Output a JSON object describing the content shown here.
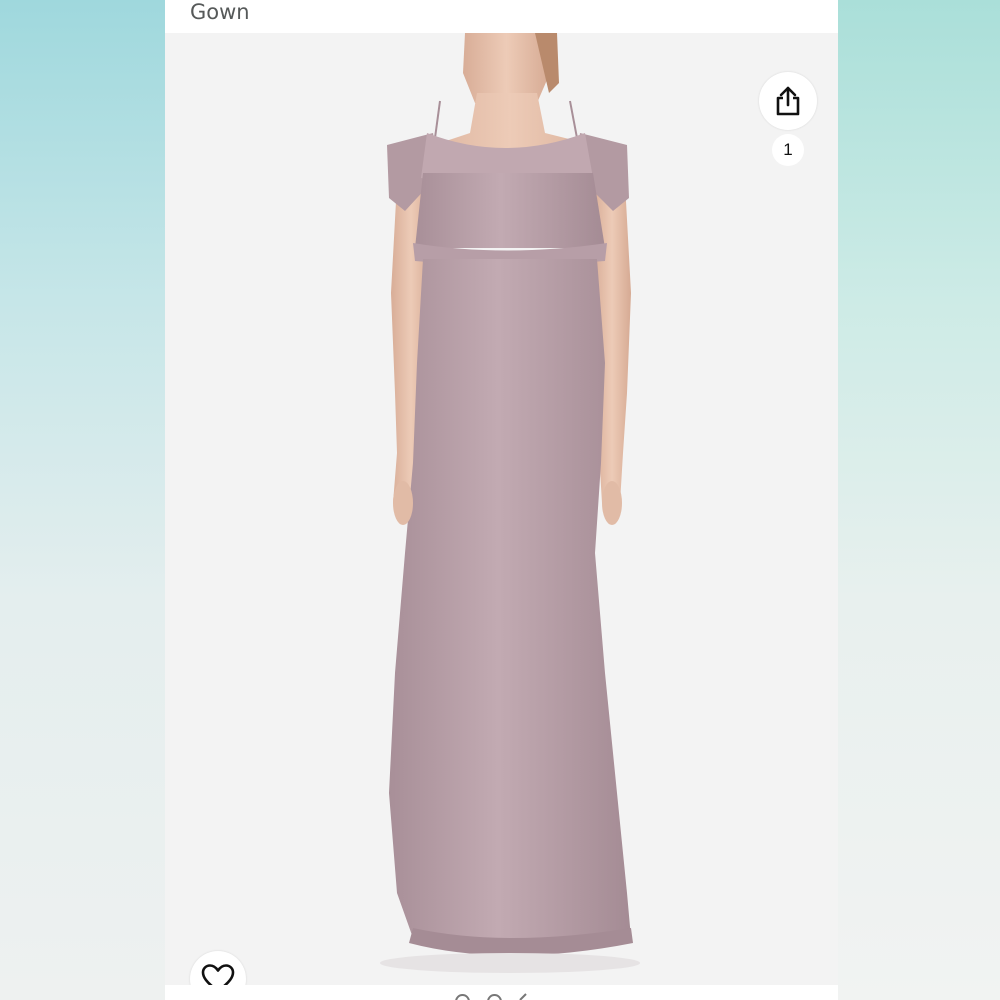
{
  "product": {
    "title": "Gown",
    "dress_color": "#b89ea6"
  },
  "share": {
    "icon": "share-icon",
    "count": "1"
  },
  "favorite": {
    "icon": "heart-outline-icon"
  },
  "carousel": {
    "icon": "carousel-dots-icon"
  }
}
